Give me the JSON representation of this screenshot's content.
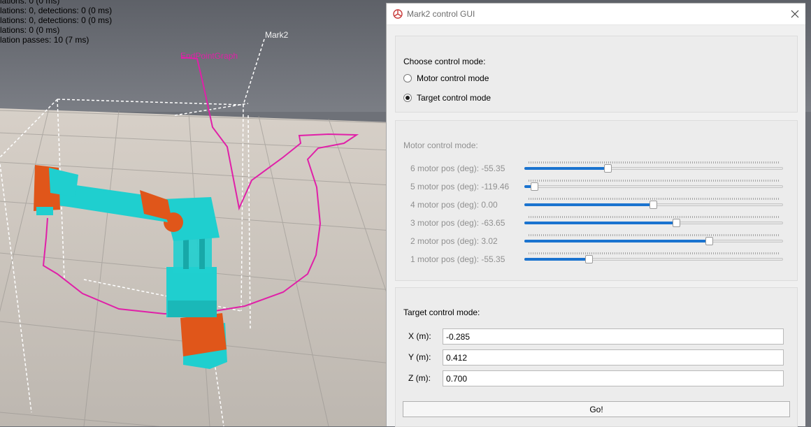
{
  "console": {
    "lines": [
      "lations: 0 (0 ms)",
      "lations: 0, detections: 0 (0 ms)",
      "lations: 0, detections: 0 (0 ms)",
      "lations: 0 (0 ms)",
      "lation passes: 10 (7 ms)"
    ]
  },
  "scene": {
    "endpoint_label": "EndPointGraph",
    "mark2_label": "Mark2",
    "graph_color": "#e020a8",
    "robot_body_color": "#1fcfcf",
    "robot_joint_color": "#e0561a"
  },
  "dialog": {
    "title": "Mark2 control GUI",
    "app_icon": "app-logo-icon",
    "close_icon": "close-icon",
    "mode_group": {
      "title": "Choose control mode:",
      "options": [
        {
          "label": "Motor control mode",
          "checked": false
        },
        {
          "label": "Target control mode",
          "checked": true
        }
      ]
    },
    "motor_group": {
      "title": "Motor control mode:",
      "enabled": false,
      "motors": [
        {
          "label": "6 motor pos (deg): -55.35",
          "level": 0.325
        },
        {
          "label": "5 motor pos (deg): -119.46",
          "level": 0.04
        },
        {
          "label": "4 motor pos (deg): 0.00",
          "level": 0.5
        },
        {
          "label": "3 motor pos (deg): -63.65",
          "level": 0.59
        },
        {
          "label": "2 motor pos (deg): 3.02",
          "level": 0.715
        },
        {
          "label": "1 motor pos (deg): -55.35",
          "level": 0.25
        }
      ]
    },
    "target_group": {
      "title": "Target control mode:",
      "fields": [
        {
          "label": "X (m):",
          "value": "-0.285"
        },
        {
          "label": "Y (m):",
          "value": "0.412"
        },
        {
          "label": "Z (m):",
          "value": "0.700"
        }
      ],
      "go_label": "Go!"
    }
  }
}
